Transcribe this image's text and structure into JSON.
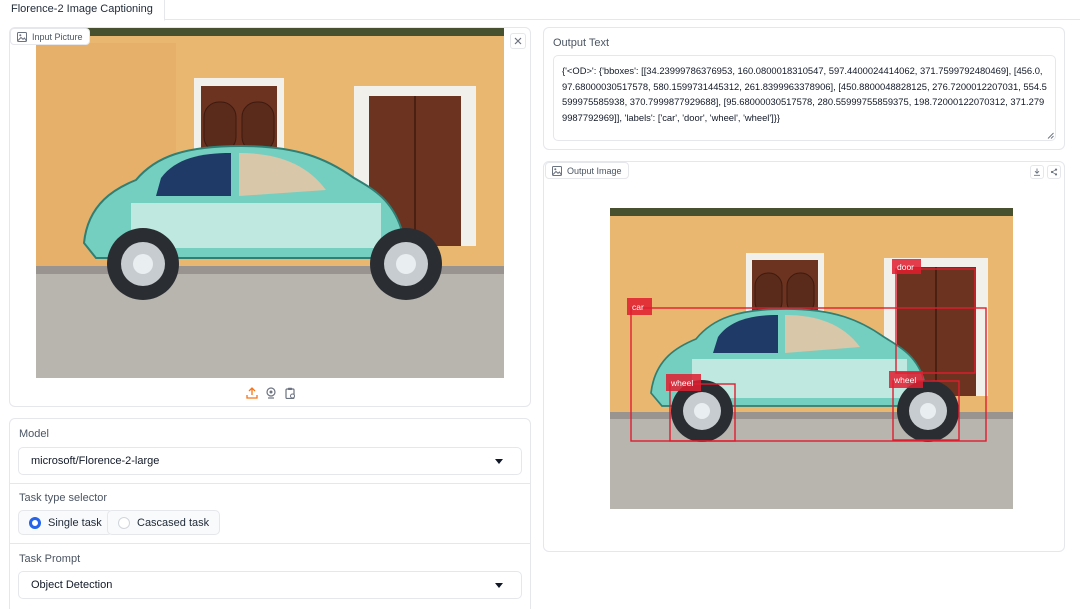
{
  "tab": {
    "label": "Florence-2 Image Captioning"
  },
  "input": {
    "label": "Input Picture",
    "icons": [
      "image-icon",
      "close-icon",
      "upload-icon",
      "webcam-icon",
      "clipboard-icon"
    ]
  },
  "controls": {
    "model": {
      "label": "Model",
      "value": "microsoft/Florence-2-large"
    },
    "task_type": {
      "label": "Task type selector",
      "options": [
        {
          "label": "Single task",
          "selected": true
        },
        {
          "label": "Cascased task",
          "selected": false
        }
      ]
    },
    "task_prompt": {
      "label": "Task Prompt",
      "value": "Object Detection"
    }
  },
  "output_text": {
    "label": "Output Text",
    "value": "{'<OD>': {'bboxes': [[34.23999786376953, 160.0800018310547, 597.4400024414062, 371.7599792480469], [456.0, 97.68000030517578, 580.1599731445312, 261.8399963378906], [450.8800048828125, 276.7200012207031, 554.5599975585938, 370.7999877929688], [95.68000030517578, 280.55999755859375, 198.72000122070312, 371.2799987792969]], 'labels': ['car', 'door', 'wheel', 'wheel']}}"
  },
  "output_image": {
    "label": "Output Image",
    "icons": [
      "download-icon",
      "share-icon"
    ],
    "detections": [
      {
        "label": "car"
      },
      {
        "label": "door"
      },
      {
        "label": "wheel"
      },
      {
        "label": "wheel"
      }
    ]
  },
  "colors": {
    "accent": "#2563eb",
    "bbox": "#e11d2f",
    "car_body": "#74cfc0",
    "wall": "#e9b76f",
    "door": "#6b3320"
  }
}
